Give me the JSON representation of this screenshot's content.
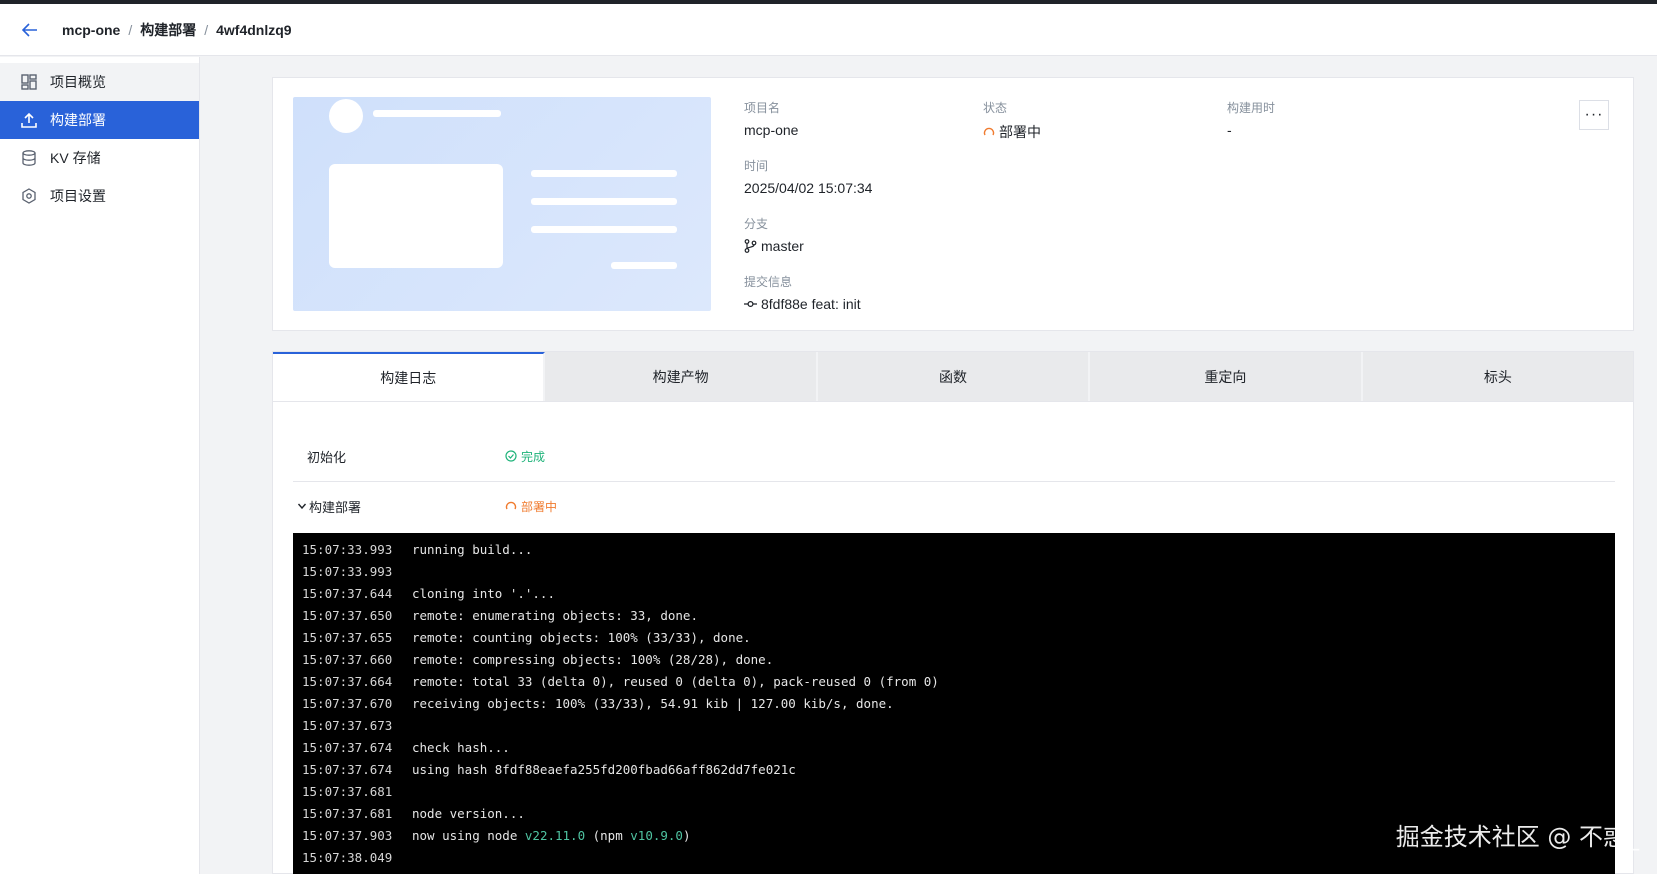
{
  "header": {
    "breadcrumbs": [
      "mcp-one",
      "构建部署",
      "4wf4dnlzq9"
    ]
  },
  "sidebar": {
    "items": [
      {
        "label": "项目概览",
        "icon": "dashboard-icon"
      },
      {
        "label": "构建部署",
        "icon": "upload-icon"
      },
      {
        "label": "KV 存储",
        "icon": "database-icon"
      },
      {
        "label": "项目设置",
        "icon": "settings-icon"
      }
    ],
    "active_index": 1
  },
  "project": {
    "name_label": "项目名",
    "name": "mcp-one",
    "status_label": "状态",
    "status": "部署中",
    "duration_label": "构建用时",
    "duration": "-",
    "time_label": "时间",
    "time": "2025/04/02 15:07:34",
    "branch_label": "分支",
    "branch": "master",
    "commit_label": "提交信息",
    "commit": "8fdf88e feat: init",
    "more_label": "···"
  },
  "tabs": [
    "构建日志",
    "构建产物",
    "函数",
    "重定向",
    "标头"
  ],
  "active_tab": 0,
  "steps": [
    {
      "name": "初始化",
      "status": "完成"
    },
    {
      "name": "构建部署",
      "status": "部署中"
    }
  ],
  "logs": [
    {
      "time": "15:07:33.993",
      "msg": "running build..."
    },
    {
      "time": "15:07:33.993",
      "msg": ""
    },
    {
      "time": "15:07:37.644",
      "msg": "cloning into '.'..."
    },
    {
      "time": "15:07:37.650",
      "msg": "remote: enumerating objects: 33, done."
    },
    {
      "time": "15:07:37.655",
      "msg": "remote: counting objects: 100% (33/33), done."
    },
    {
      "time": "15:07:37.660",
      "msg": "remote: compressing objects: 100% (28/28), done."
    },
    {
      "time": "15:07:37.664",
      "msg": "remote: total 33 (delta 0), reused 0 (delta 0), pack-reused 0 (from 0)"
    },
    {
      "time": "15:07:37.670",
      "msg": "receiving objects: 100% (33/33), 54.91 kib | 127.00 kib/s, done."
    },
    {
      "time": "15:07:37.673",
      "msg": ""
    },
    {
      "time": "15:07:37.674",
      "msg": "check hash..."
    },
    {
      "time": "15:07:37.674",
      "msg": "using hash 8fdf88eaefa255fd200fbad66aff862dd7fe021c"
    },
    {
      "time": "15:07:37.681",
      "msg": ""
    },
    {
      "time": "15:07:37.681",
      "msg": "node version..."
    },
    {
      "time": "15:07:37.903",
      "msg": "now using node ",
      "node_ver": "v22.11.0",
      "mid": " (npm ",
      "npm_ver": "v10.9.0",
      "end": ")"
    },
    {
      "time": "15:07:38.049",
      "msg": ""
    }
  ],
  "watermark": "掘金技术社区 @ 不惑_",
  "colors": {
    "accent": "#2962d9",
    "deploying": "#f07b2f",
    "done": "#1fb37a",
    "terminal_bg": "#000000"
  }
}
